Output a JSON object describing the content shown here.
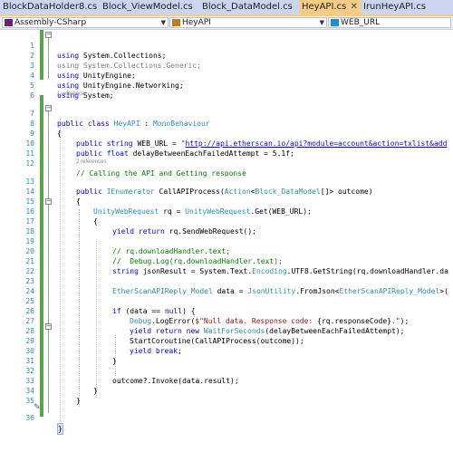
{
  "tabs": [
    {
      "label": "BlockDataHolder8.cs",
      "active": false
    },
    {
      "label": "Block_ViewModel.cs",
      "active": false
    },
    {
      "label": "Block_DataModel.cs",
      "active": false
    },
    {
      "label": "HeyAPI.cs",
      "active": true
    },
    {
      "label": "IrunHeyAPI.cs",
      "active": false
    }
  ],
  "navbar": {
    "project": "Assembly-CSharp",
    "class": "HeyAPI",
    "member": "WEB_URL"
  },
  "editor": {
    "line_numbers": [
      "1",
      "2",
      "3",
      "4",
      "5",
      "6",
      "7",
      "8",
      "9",
      "10",
      "11",
      "12",
      "13",
      "14",
      "15",
      "16",
      "17",
      "18",
      "19",
      "20",
      "21",
      "22",
      "23",
      "24",
      "25",
      "26",
      "27",
      "28",
      "29",
      "30",
      "31",
      "32",
      "33",
      "34",
      "35",
      "36"
    ],
    "references": [
      "1 reference",
      "2 references"
    ],
    "lines": {
      "l1": [
        "using ",
        "System.Collections;"
      ],
      "l2": [
        "using ",
        "System.Collections.Generic;"
      ],
      "l3": [
        "using ",
        "UnityEngine;"
      ],
      "l4": [
        "using ",
        "UnityEngine.Networking;"
      ],
      "l5": [
        "using ",
        "System;"
      ],
      "l7": [
        "public ",
        "class ",
        "HeyAPI",
        " : ",
        "MonoBehaviour"
      ],
      "l8": "{",
      "l9": [
        "public ",
        "string ",
        "WEB_URL = ",
        "\"",
        "http://api.etherscan.io/api?module=account&action=txlist&add"
      ],
      "l10": [
        "public ",
        "float ",
        "delayBetweenEachFailedAttempt = 5.1f;"
      ],
      "l12": "// Calling the API and Getting response",
      "l13": [
        "public ",
        "IEnumerator",
        " CallAPIProcess(",
        "Action",
        "<",
        "Block_DataModel",
        "[]> outcome)"
      ],
      "l14": "{",
      "l15": [
        "UnityWebRequest",
        " rq = ",
        "UnityWebRequest",
        ".Get(WEB_URL);"
      ],
      "l16": "{",
      "l17": [
        "yield ",
        "return ",
        "rq.SendWebRequest();"
      ],
      "l19": "// rq.downloadHandler.text;",
      "l20": "//  Debug.Log(rq.downloadHandler.text);",
      "l21": [
        "string ",
        "jsonResult = System.Text.",
        "Encoding",
        ".UTF8.GetString(rq.downloadHandler.da"
      ],
      "l23": [
        "EtherScanAPIReply_Model",
        " data = ",
        "JsonUtility",
        ".FromJson<",
        "EtherScanAPIReply_Model",
        ">("
      ],
      "l25": [
        "if ",
        "(data == ",
        "null",
        ") {"
      ],
      "l26": [
        "Debug",
        ".LogError(",
        "$\"Null data. Response code: ",
        "{rq.responseCode}",
        ".\"",
        ");"
      ],
      "l27": [
        "yield ",
        "return ",
        "new ",
        "WaitForSeconds",
        "(delayBetweenEachFailedAttempt);"
      ],
      "l28": "StartCoroutine(CallAPIProcess(outcome));",
      "l29": [
        "yield ",
        "break",
        ";"
      ],
      "l30": "}",
      "l32": "outcome?.Invoke(data.result);",
      "l33": "}",
      "l34": "}",
      "l35": "}",
      "l36": "}"
    }
  },
  "colors": {
    "keyword": "#0000ff",
    "type": "#2b91af",
    "string": "#a31515",
    "comment": "#008000",
    "line_number": "#2b91af",
    "active_tab": "#f5cc84",
    "tabbar": "#ccd5f0"
  }
}
